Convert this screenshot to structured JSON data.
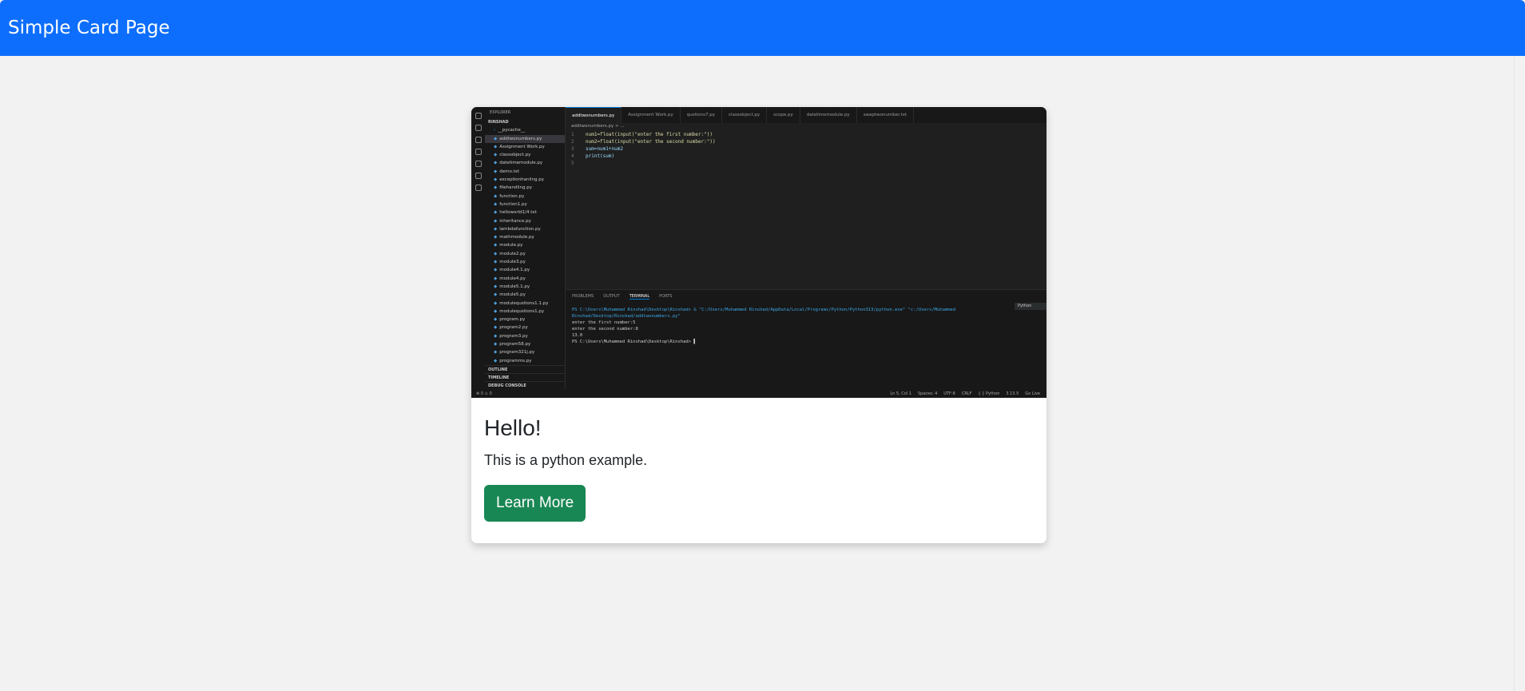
{
  "navbar": {
    "title": "Simple Card Page",
    "color": "#0d6efd"
  },
  "card": {
    "title": "Hello!",
    "text": "This is a python example.",
    "button_label": "Learn More",
    "button_color": "#198754",
    "image": {
      "explorer_label": "EXPLORER",
      "folder": "RINSHAD",
      "files": [
        "__pycache__",
        "addtwonumbers.py",
        "Assignment Work.py",
        "classobject.py",
        "datetimemodule.py",
        "demo.txt",
        "exceptionhanling.py",
        "filehandling.py",
        "function.py",
        "function1.py",
        "helloworld1/4.txt",
        "inheritance.py",
        "lambdafunction.py",
        "mathmodule.py",
        "module.py",
        "module2.py",
        "module3.py",
        "module4.1.py",
        "module4.py",
        "module5.1.py",
        "module5.py",
        "modulequstions1.1.py",
        "modulequstions1.py",
        "program.py",
        "program2.py",
        "program3.py",
        "program58.py",
        "program321j.py",
        "programms.py"
      ],
      "sections": [
        "OUTLINE",
        "TIMELINE",
        "DEBUG CONSOLE"
      ],
      "tabs": [
        "addtwonumbers.py",
        "Assignment Work.py",
        "qustions7.py",
        "classobject.py",
        "scope.py",
        "datetimemodule.py",
        "swaptwonumber.txt"
      ],
      "breadcrumb": "addtwonumbers.py > ...",
      "code": [
        "num1=float(input(\"enter the first number:\"))",
        "num2=float(input(\"enter the second number:\"))",
        "sum=num1+num2",
        "print(sum)",
        ""
      ],
      "panel_tabs": [
        "PROBLEMS",
        "OUTPUT",
        "TERMINAL",
        "PORTS"
      ],
      "terminal_name": "Python",
      "terminal": [
        "PS C:\\Users\\Muhammed Rinshad\\Desktop\\Rinshad> & \"C:/Users/Muhammed Rinshad/AppData/Local/Programs/Python/Python313/python.exe\" \"c:/Users/Muhammed Rinshad/Desktop/Rinshad/addtwonumbers.py\"",
        "enter the first number:5",
        "enter the second number:8",
        "13.0",
        "PS C:\\Users\\Muhammed Rinshad\\Desktop\\Rinshad> ▌"
      ],
      "status_left": "⊗ 0 ⚠ 0",
      "status_right": [
        "Ln 5, Col 1",
        "Spaces: 4",
        "UTF-8",
        "CRLF",
        "{ } Python",
        "3.13.5",
        "Go Live"
      ]
    }
  }
}
